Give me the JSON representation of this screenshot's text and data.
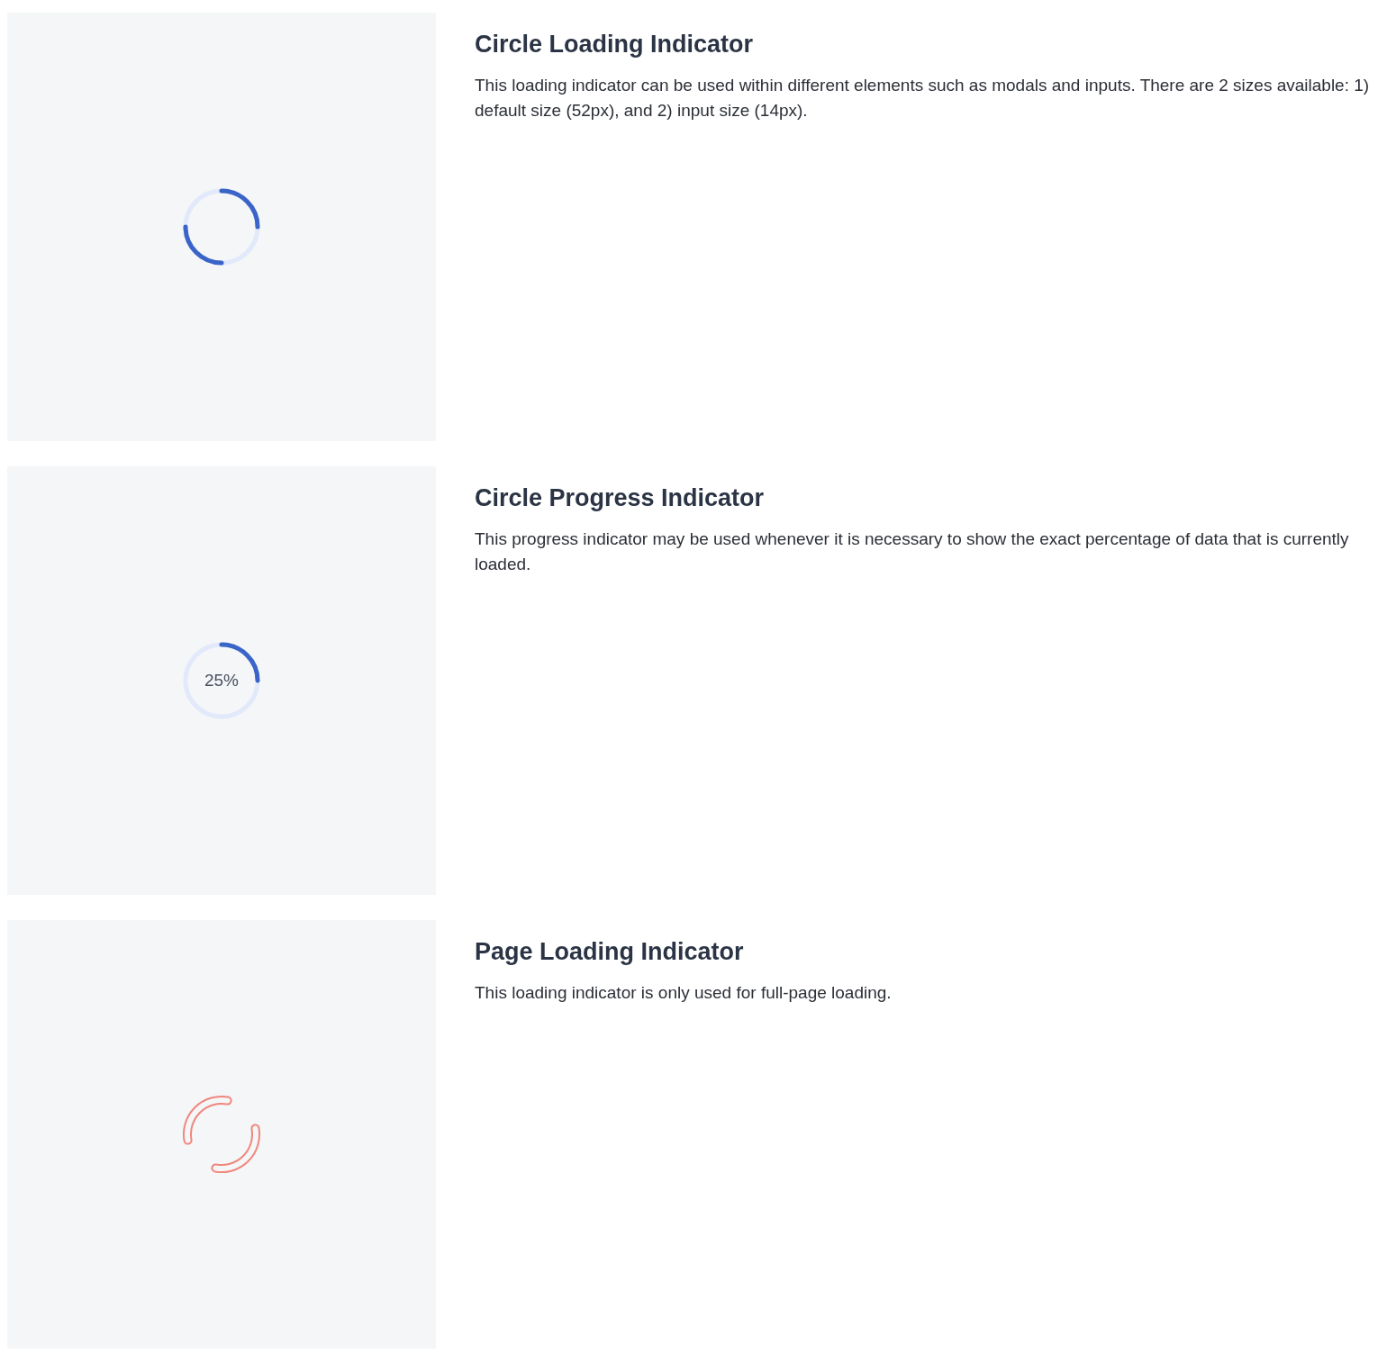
{
  "sections": [
    {
      "kind": "spinner",
      "title": "Circle Loading Indicator",
      "description": "This loading indicator can be used within different elements such as modals and inputs. There are 2 sizes available: 1) default size (52px), and 2) input size (14px)."
    },
    {
      "kind": "progress",
      "title": "Circle Progress Indicator",
      "description": "This progress indicator may be used whenever it is necessary to show the exact percentage of data that is currently loaded.",
      "level": 0.25,
      "label": "25%"
    },
    {
      "kind": "page",
      "title": "Page Loading Indicator",
      "description": "This loading indicator is only used for full-page loading."
    }
  ]
}
